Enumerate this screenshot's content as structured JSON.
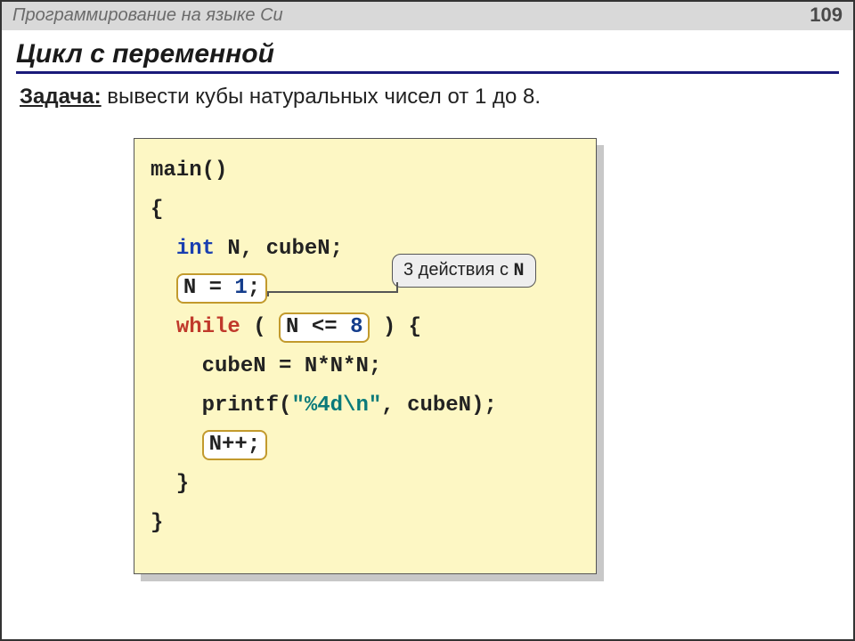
{
  "header": {
    "subject": "Программирование на языке Си",
    "page": "109"
  },
  "title": "Цикл с переменной",
  "task": {
    "label": "Задача:",
    "text": " вывести кубы натуральных чисел от 1 до 8."
  },
  "code": {
    "l1": "main()",
    "l2": "{",
    "l3a": "  ",
    "l3_kw": "int",
    "l3b": " N, cubeN;",
    "l4a": "  ",
    "l4_box_a": "N = ",
    "l4_box_b": "1",
    "l4_box_c": ";",
    "l5a": "  ",
    "l5_kw": "while",
    "l5b": " ( ",
    "l5_box_a": "N <= ",
    "l5_box_b": "8",
    "l5c": " ) {",
    "l6": "    cubeN = N*N*N;",
    "l7a": "    printf(",
    "l7_fmt": "\"%4d\\n\"",
    "l7b": ", cubeN);",
    "l8a": "    ",
    "l8_box": "N++;",
    "l9": "  }",
    "l10": "}"
  },
  "callout": {
    "text_a": "3 действия с ",
    "text_b": "N"
  }
}
